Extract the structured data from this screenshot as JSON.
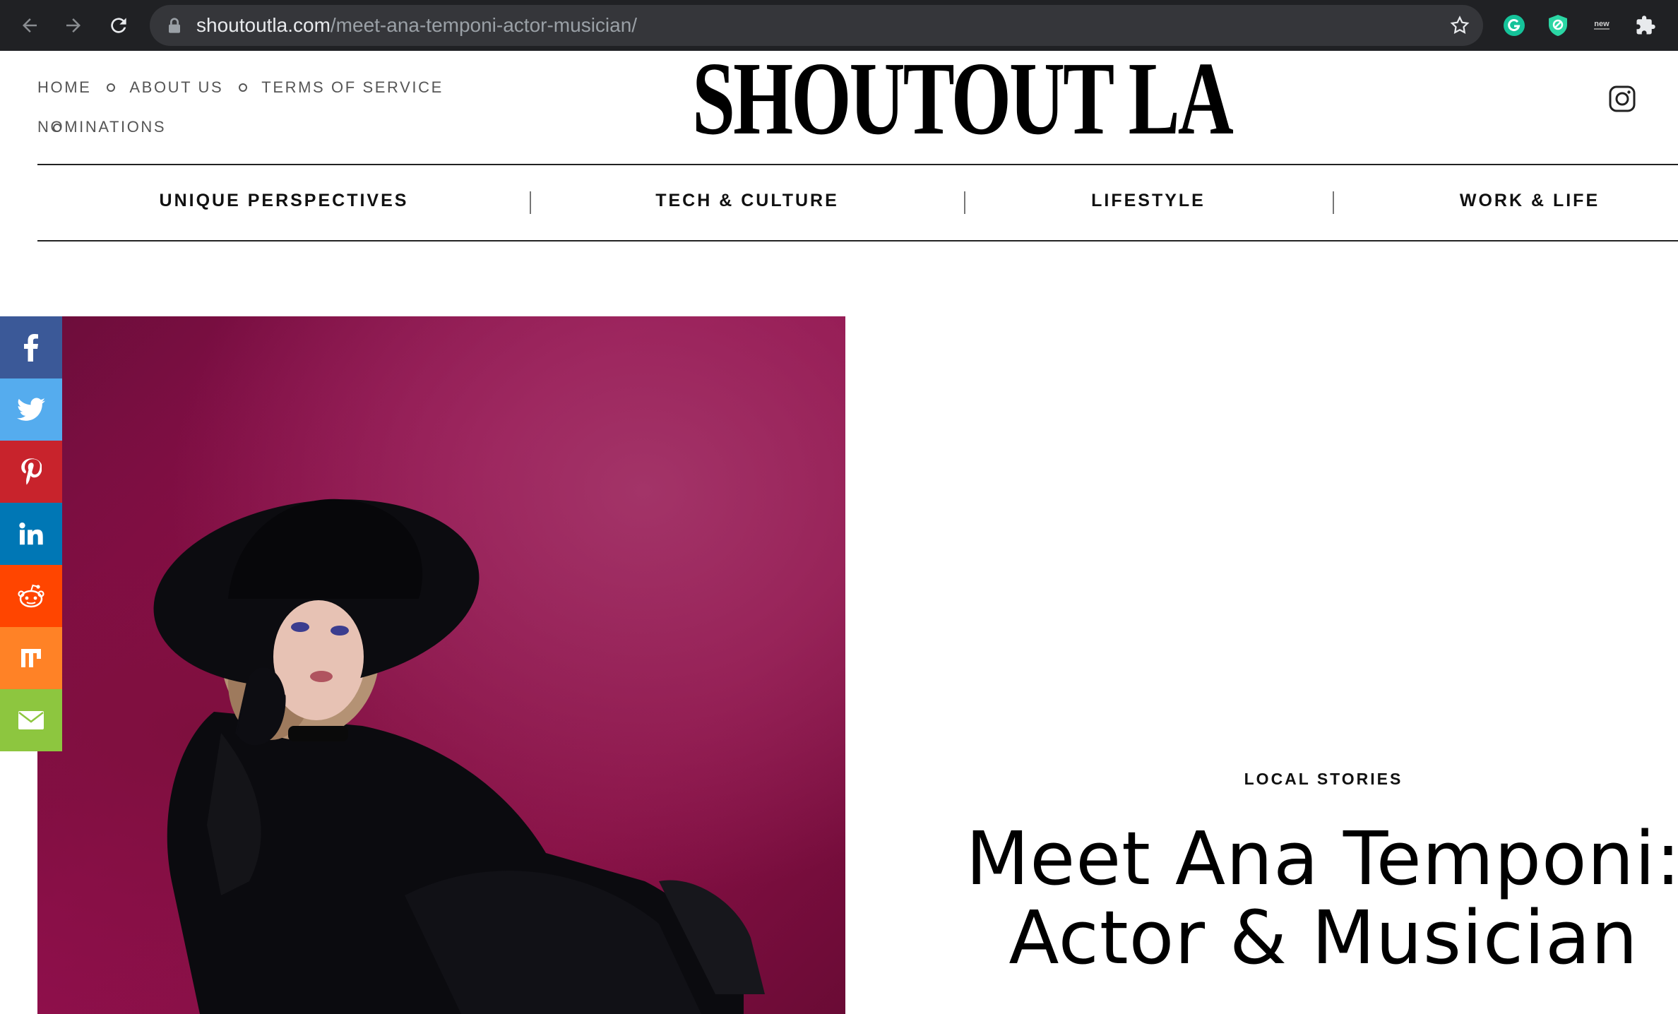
{
  "browser": {
    "url_host": "shoutoutla.com",
    "url_path": "/meet-ana-temponi-actor-musician/"
  },
  "header": {
    "top_links": [
      "HOME",
      "ABOUT US",
      "TERMS OF SERVICE",
      "NOMINATIONS"
    ],
    "logo": "SHOUTOUT LA"
  },
  "categories": [
    "UNIQUE PERSPECTIVES",
    "TECH & CULTURE",
    "LIFESTYLE",
    "WORK & LIFE"
  ],
  "share": {
    "facebook_color": "#3b5998",
    "twitter_color": "#55acee",
    "pinterest_color": "#c8232c",
    "linkedin_color": "#0077b5",
    "reddit_color": "#ff4500",
    "mix_color": "#ff8226",
    "email_color": "#8dc63f"
  },
  "article": {
    "kicker": "LOCAL STORIES",
    "title_line1": "Meet Ana Temponi:",
    "title_line2": "Actor & Musician"
  }
}
